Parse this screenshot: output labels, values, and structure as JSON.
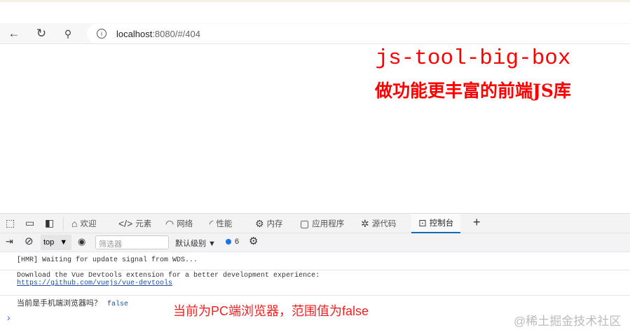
{
  "browser": {
    "url_host": "localhost",
    "url_rest": ":8080/#/404"
  },
  "page": {
    "title": "js-tool-big-box",
    "subtitle": "做功能更丰富的前端JS库"
  },
  "devtools": {
    "tabs": [
      {
        "label": "欢迎",
        "icon": "home-icon"
      },
      {
        "label": "元素",
        "icon": "code-icon"
      },
      {
        "label": "网络",
        "icon": "wifi-icon"
      },
      {
        "label": "性能",
        "icon": "performance-icon"
      },
      {
        "label": "内存",
        "icon": "chip-icon"
      },
      {
        "label": "应用程序",
        "icon": "app-icon"
      },
      {
        "label": "源代码",
        "icon": "bug-icon"
      },
      {
        "label": "控制台",
        "icon": "console-icon"
      }
    ],
    "context": "top",
    "filter_placeholder": "筛选器",
    "level": "默认级别 ▼",
    "message_count": "6",
    "console": {
      "hmr": "[HMR] Waiting for update signal from WDS...",
      "vue_msg": "Download the Vue Devtools extension for a better development experience:",
      "vue_link": "https://github.com/vuejs/vue-devtools",
      "question": "当前是手机端浏览器吗？",
      "value": "false"
    }
  },
  "annotation": "当前为PC端浏览器，范围值为false",
  "watermark": "@稀土掘金技术社区"
}
